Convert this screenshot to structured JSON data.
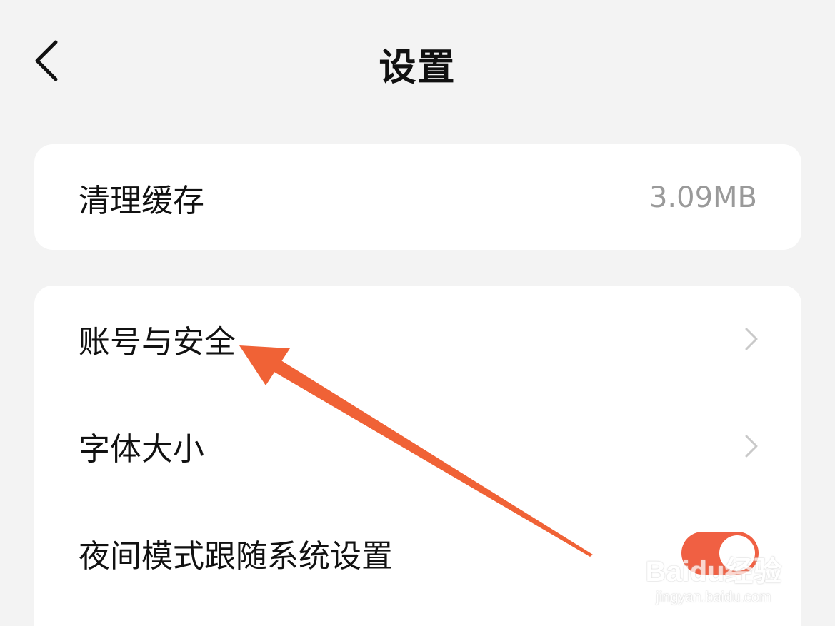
{
  "header": {
    "title": "设置",
    "back_icon": "chevron-left-icon"
  },
  "cache_card": {
    "label": "清理缓存",
    "value": "3.09MB"
  },
  "settings_card": {
    "items": [
      {
        "label": "账号与安全",
        "trailing": "chevron-right-icon"
      },
      {
        "label": "字体大小",
        "trailing": "chevron-right-icon"
      },
      {
        "label": "夜间模式跟随系统设置",
        "trailing": "toggle",
        "toggle_on": true
      }
    ]
  },
  "annotation": {
    "arrow_color": "#f06236",
    "target": "账号与安全"
  },
  "watermark": {
    "logo": "Baidu经验",
    "url": "jingyan.baidu.com"
  },
  "colors": {
    "background": "#f3f3f3",
    "card": "#ffffff",
    "primary_text": "#111111",
    "secondary_text": "#9a9a9a",
    "chevron": "#c9c9c9",
    "toggle_on": "#f06043"
  }
}
